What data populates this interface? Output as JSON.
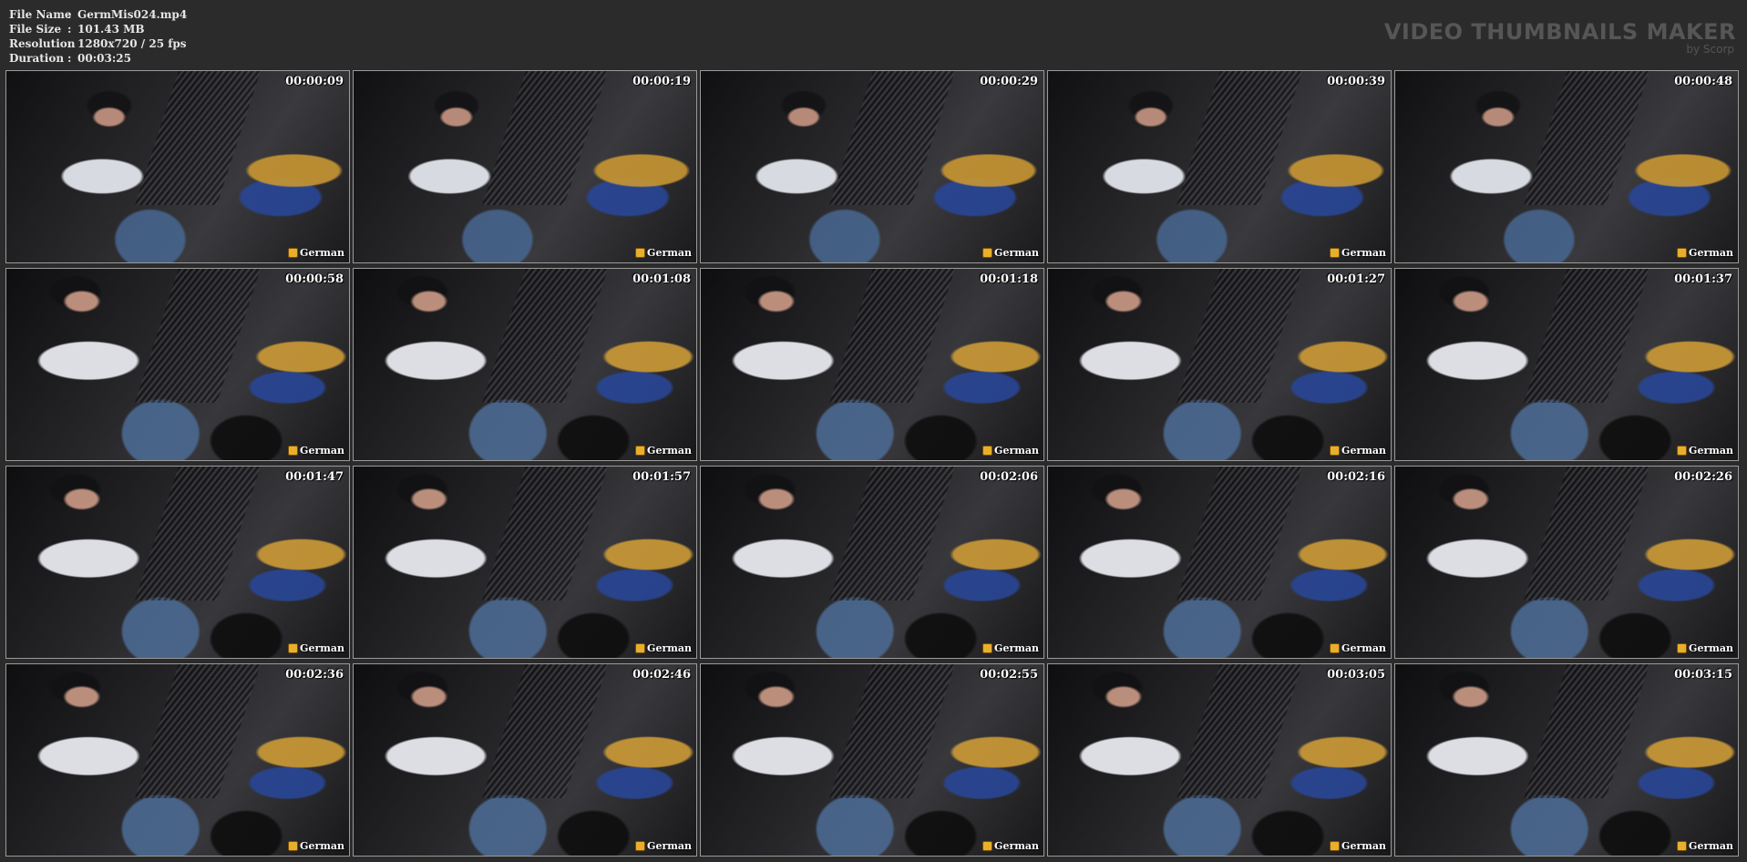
{
  "file_info": {
    "file_name_label": "File Name",
    "file_name_value": "GermMis024.mp4",
    "file_size_label": "File Size",
    "file_size_value": "101.43 MB",
    "resolution_label": "Resolution",
    "resolution_value": "1280x720 / 25 fps",
    "duration_label": "Duration",
    "duration_value": "00:03:25",
    "separator": ":"
  },
  "brand": {
    "title": "VIDEO THUMBNAILS MAKER",
    "subtitle": "by Scorp"
  },
  "watermark": {
    "text": "German",
    "accent_color": "#e8b02a"
  },
  "thumbnails": [
    {
      "time": "00:00:09"
    },
    {
      "time": "00:00:19"
    },
    {
      "time": "00:00:29"
    },
    {
      "time": "00:00:39"
    },
    {
      "time": "00:00:48"
    },
    {
      "time": "00:00:58"
    },
    {
      "time": "00:01:08"
    },
    {
      "time": "00:01:18"
    },
    {
      "time": "00:01:27"
    },
    {
      "time": "00:01:37"
    },
    {
      "time": "00:01:47"
    },
    {
      "time": "00:01:57"
    },
    {
      "time": "00:02:06"
    },
    {
      "time": "00:02:16"
    },
    {
      "time": "00:02:26"
    },
    {
      "time": "00:02:36"
    },
    {
      "time": "00:02:46"
    },
    {
      "time": "00:02:55"
    },
    {
      "time": "00:03:05"
    },
    {
      "time": "00:03:15"
    }
  ]
}
